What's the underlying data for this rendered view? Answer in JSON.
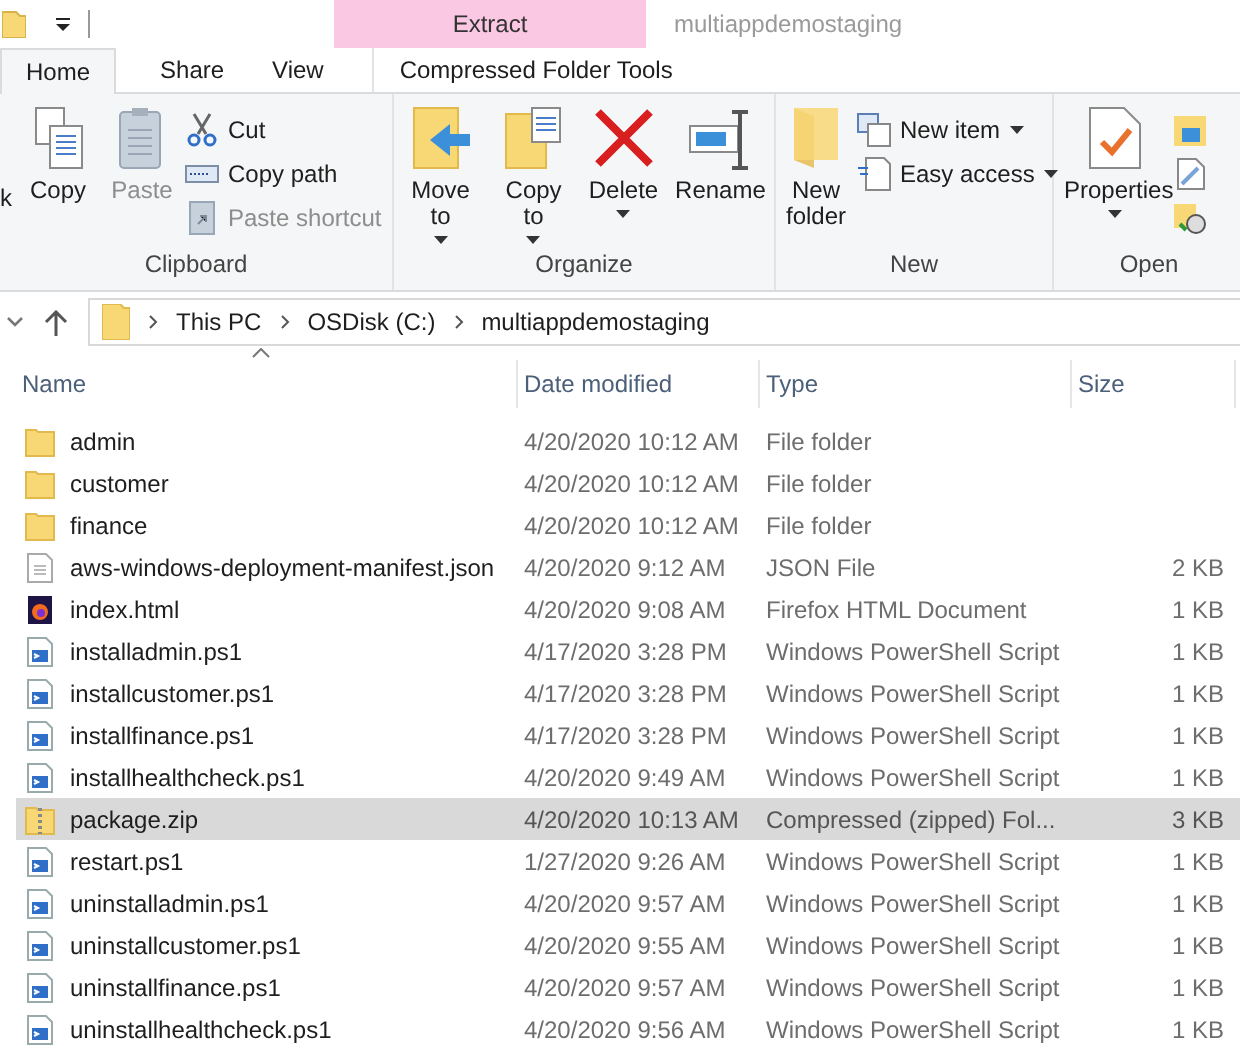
{
  "window": {
    "title": "multiappdemostaging"
  },
  "context_tab": {
    "label": "Extract"
  },
  "tabs": [
    {
      "label": "Home",
      "selected": true
    },
    {
      "label": "Share",
      "selected": false
    },
    {
      "label": "View",
      "selected": false
    },
    {
      "label": "Compressed Folder Tools",
      "selected": false
    }
  ],
  "ribbon": {
    "groups": [
      {
        "name": "Clipboard",
        "cut_label": "k",
        "large": [
          {
            "label": "Copy",
            "disabled": false,
            "dropdown": false
          },
          {
            "label": "Paste",
            "disabled": true,
            "dropdown": false
          }
        ],
        "small": [
          {
            "label": "Cut",
            "disabled": false,
            "dropdown": false
          },
          {
            "label": "Copy path",
            "disabled": false,
            "dropdown": false
          },
          {
            "label": "Paste shortcut",
            "disabled": true,
            "dropdown": false
          }
        ]
      },
      {
        "name": "Organize",
        "large": [
          {
            "label": "Move to",
            "disabled": false,
            "dropdown": true
          },
          {
            "label": "Copy to",
            "disabled": false,
            "dropdown": true
          },
          {
            "label": "Delete",
            "disabled": false,
            "dropdown": true
          },
          {
            "label": "Rename",
            "disabled": false,
            "dropdown": false
          }
        ]
      },
      {
        "name": "New",
        "large": [
          {
            "label": "New folder",
            "disabled": false,
            "dropdown": false
          }
        ],
        "small": [
          {
            "label": "New item",
            "disabled": false,
            "dropdown": true
          },
          {
            "label": "Easy access",
            "disabled": false,
            "dropdown": true
          }
        ]
      },
      {
        "name": "Open",
        "large": [
          {
            "label": "Properties",
            "disabled": false,
            "dropdown": true
          }
        ]
      }
    ]
  },
  "address": {
    "crumbs": [
      "This PC",
      "OSDisk (C:)",
      "multiappdemostaging"
    ]
  },
  "table": {
    "columns": [
      "Name",
      "Date modified",
      "Type",
      "Size"
    ],
    "rows": [
      {
        "kind": "folder",
        "name": "admin",
        "date": "4/20/2020 10:12 AM",
        "type": "File folder",
        "size": "",
        "selected": false
      },
      {
        "kind": "folder",
        "name": "customer",
        "date": "4/20/2020 10:12 AM",
        "type": "File folder",
        "size": "",
        "selected": false
      },
      {
        "kind": "folder",
        "name": "finance",
        "date": "4/20/2020 10:12 AM",
        "type": "File folder",
        "size": "",
        "selected": false
      },
      {
        "kind": "json",
        "name": "aws-windows-deployment-manifest.json",
        "date": "4/20/2020 9:12 AM",
        "type": "JSON File",
        "size": "2 KB",
        "selected": false
      },
      {
        "kind": "html",
        "name": "index.html",
        "date": "4/20/2020 9:08 AM",
        "type": "Firefox HTML Document",
        "size": "1 KB",
        "selected": false
      },
      {
        "kind": "ps1",
        "name": "installadmin.ps1",
        "date": "4/17/2020 3:28 PM",
        "type": "Windows PowerShell Script",
        "size": "1 KB",
        "selected": false
      },
      {
        "kind": "ps1",
        "name": "installcustomer.ps1",
        "date": "4/17/2020 3:28 PM",
        "type": "Windows PowerShell Script",
        "size": "1 KB",
        "selected": false
      },
      {
        "kind": "ps1",
        "name": "installfinance.ps1",
        "date": "4/17/2020 3:28 PM",
        "type": "Windows PowerShell Script",
        "size": "1 KB",
        "selected": false
      },
      {
        "kind": "ps1",
        "name": "installhealthcheck.ps1",
        "date": "4/20/2020 9:49 AM",
        "type": "Windows PowerShell Script",
        "size": "1 KB",
        "selected": false
      },
      {
        "kind": "zip",
        "name": "package.zip",
        "date": "4/20/2020 10:13 AM",
        "type": "Compressed (zipped) Fol...",
        "size": "3 KB",
        "selected": true
      },
      {
        "kind": "ps1",
        "name": "restart.ps1",
        "date": "1/27/2020 9:26 AM",
        "type": "Windows PowerShell Script",
        "size": "1 KB",
        "selected": false
      },
      {
        "kind": "ps1",
        "name": "uninstalladmin.ps1",
        "date": "4/20/2020 9:57 AM",
        "type": "Windows PowerShell Script",
        "size": "1 KB",
        "selected": false
      },
      {
        "kind": "ps1",
        "name": "uninstallcustomer.ps1",
        "date": "4/20/2020 9:55 AM",
        "type": "Windows PowerShell Script",
        "size": "1 KB",
        "selected": false
      },
      {
        "kind": "ps1",
        "name": "uninstallfinance.ps1",
        "date": "4/20/2020 9:57 AM",
        "type": "Windows PowerShell Script",
        "size": "1 KB",
        "selected": false
      },
      {
        "kind": "ps1",
        "name": "uninstallhealthcheck.ps1",
        "date": "4/20/2020 9:56 AM",
        "type": "Windows PowerShell Script",
        "size": "1 KB",
        "selected": false
      }
    ]
  }
}
